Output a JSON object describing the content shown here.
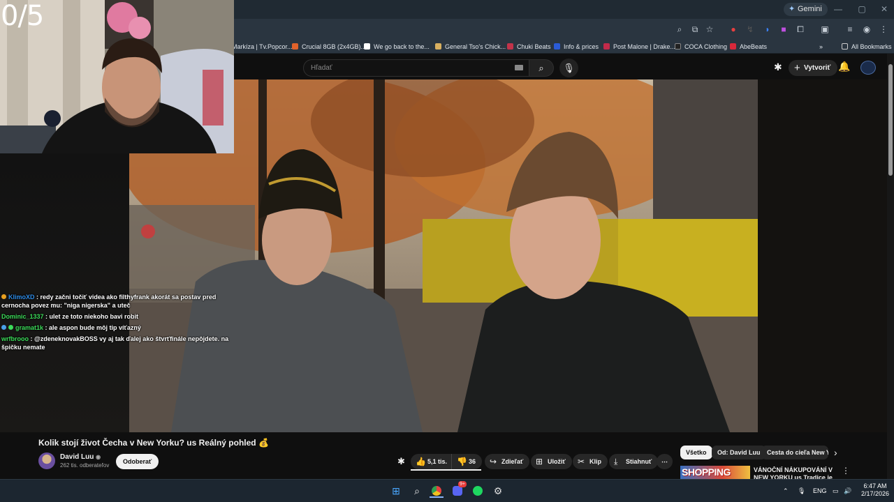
{
  "browser": {
    "gemini_label": "Gemini",
    "bookmarks": [
      {
        "label": "Markíza | Tv.Popcor...",
        "color": "#4a6a8a"
      },
      {
        "label": "Crucial 8GB (2x4GB)...",
        "color": "#e0622b"
      },
      {
        "label": "We go back to the...",
        "color": "#ffffff"
      },
      {
        "label": "General Tso's Chick...",
        "color": "#d8b060"
      },
      {
        "label": "Chuki Beats",
        "color": "#c2334a"
      },
      {
        "label": "Info & prices",
        "color": "#2a5bd7"
      },
      {
        "label": "Post Malone | Drake...",
        "color": "#c22a4a"
      },
      {
        "label": "COCA Clothing",
        "color": "#222222"
      },
      {
        "label": "AbeBeats",
        "color": "#d8283a"
      }
    ],
    "all_bookmarks_label": "All Bookmarks"
  },
  "youtube": {
    "search_placeholder": "Hľadať",
    "create_label": "Vytvoriť",
    "video_title": "Kolik stojí život Čecha v New Yorku? us Reálný pohled 💰",
    "channel_name": "David Luu",
    "subscribers": "262 tis. odberateľov",
    "subscribe_label": "Odoberať",
    "likes": "5,1 tis.",
    "dislikes": "36",
    "share_label": "Zdieľať",
    "save_label": "Uložiť",
    "clip_label": "Klip",
    "download_label": "Stiahnuť",
    "chips": [
      "Všetko",
      "Od: David Luu",
      "Cesta do cieľa New Yo"
    ],
    "recommended_thumb_text": "SHOPPING",
    "recommended_title": "VÁNOČNÍ NÁKUPOVÁNÍ V NEW YORKU us Tradice je tradice"
  },
  "stream": {
    "counter": "0/5",
    "chat": [
      {
        "user": "KlimoXD",
        "user_color": "#2e8de8",
        "badge": "#e8a020",
        "text": "redy začni točiť videa ako filthyfrank akorát sa postav pred cernocha povez mu: \"niga nigerska\" a uteč"
      },
      {
        "user": "Dominic_1337",
        "user_color": "#3cdc5a",
        "badge": "",
        "text": "ulet ze toto niekoho bavi robit"
      },
      {
        "user": "gramat1k",
        "user_color": "#3cdc5a",
        "badge": "#4aa0e8",
        "text": "ale aspon bude môj tip víťazný"
      },
      {
        "user": "wrfbrooo",
        "user_color": "#3cdc5a",
        "badge": "",
        "text": "@zdeneknovakBOSS vy aj tak ďalej ako štvrťfinále nepôjdete. na špičku nemate"
      }
    ]
  },
  "taskbar": {
    "lang": "ENG",
    "time": "6:47 AM",
    "date": "2/17/2026",
    "discord_badge": "9+"
  },
  "colors": {
    "accent": "#f1f1f1",
    "browser_bar": "#2a3540",
    "youtube_bg": "#0f0f0f"
  }
}
